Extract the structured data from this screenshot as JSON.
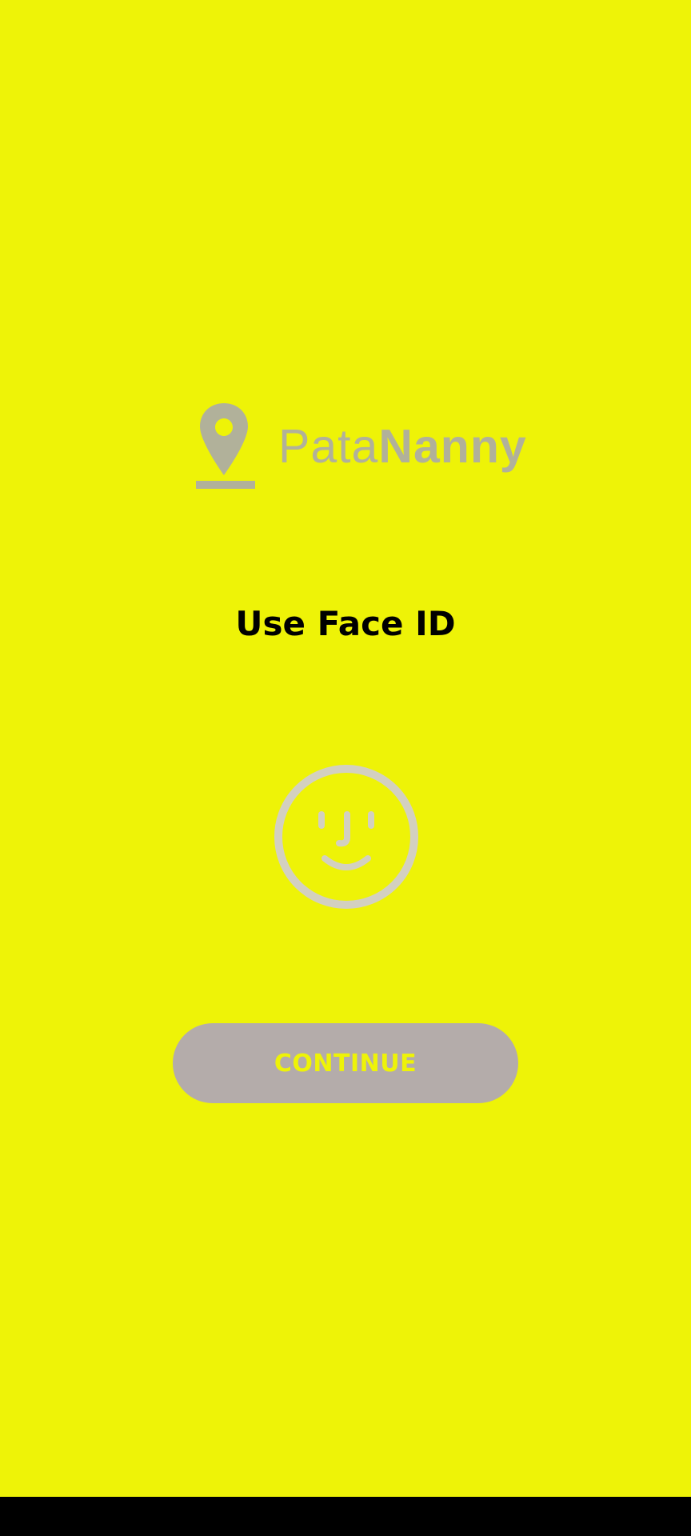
{
  "app": {
    "name_part1": "Pata",
    "name_part2": "Nanny"
  },
  "screen": {
    "title": "Use Face ID"
  },
  "actions": {
    "continue_label": "CONTINUE"
  },
  "icons": {
    "logo": "location-pin-icon",
    "face": "face-id-icon"
  },
  "colors": {
    "background": "#EEF307",
    "logo_gray": "#B1B19A",
    "face_icon": "#D3D0C0",
    "button_bg": "#B4ACAA",
    "button_text": "#EEF307",
    "title_text": "#000000",
    "nav_bar": "#000000"
  }
}
